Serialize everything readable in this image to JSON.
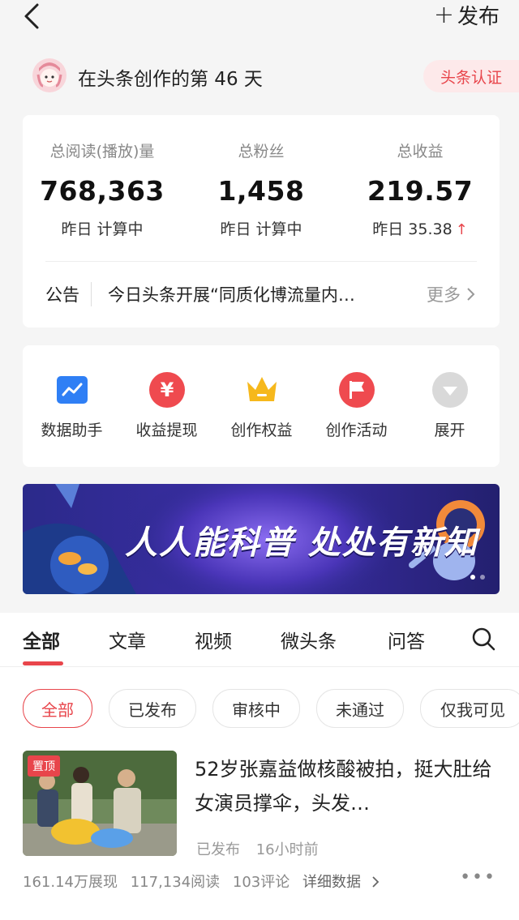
{
  "header": {
    "publish_label": "发布"
  },
  "profile": {
    "text": "在头条创作的第 46 天",
    "verify_label": "头条认证"
  },
  "stats": {
    "items": [
      {
        "label": "总阅读(播放)量",
        "value": "768,363",
        "sub": "昨日 计算中"
      },
      {
        "label": "总粉丝",
        "value": "1,458",
        "sub": "昨日 计算中"
      },
      {
        "label": "总收益",
        "value": "219.57",
        "sub": "昨日 35.38"
      }
    ],
    "notice_tag": "公告",
    "notice_text": "今日头条开展“同质化博流量内…",
    "notice_more": "更多"
  },
  "tools": [
    {
      "label": "数据助手",
      "icon": "chart-icon"
    },
    {
      "label": "收益提现",
      "icon": "yen-icon"
    },
    {
      "label": "创作权益",
      "icon": "crown-icon"
    },
    {
      "label": "创作活动",
      "icon": "flag-icon"
    },
    {
      "label": "展开",
      "icon": "expand-icon"
    }
  ],
  "banner": {
    "text": "人人能科普  处处有新知"
  },
  "tabs": [
    "全部",
    "文章",
    "视频",
    "微头条",
    "问答"
  ],
  "filters": [
    "全部",
    "已发布",
    "审核中",
    "未通过",
    "仅我可见"
  ],
  "article": {
    "pin_label": "置顶",
    "title": "52岁张嘉益做核酸被拍，挺大肚给女演员撑伞，头发…",
    "status": "已发布",
    "time": "16小时前",
    "impressions": "161.14万展现",
    "reads": "117,134阅读",
    "comments": "103评论",
    "detail": "详细数据"
  },
  "colors": {
    "accent": "#e8454b",
    "background": "#f5f5f5"
  }
}
